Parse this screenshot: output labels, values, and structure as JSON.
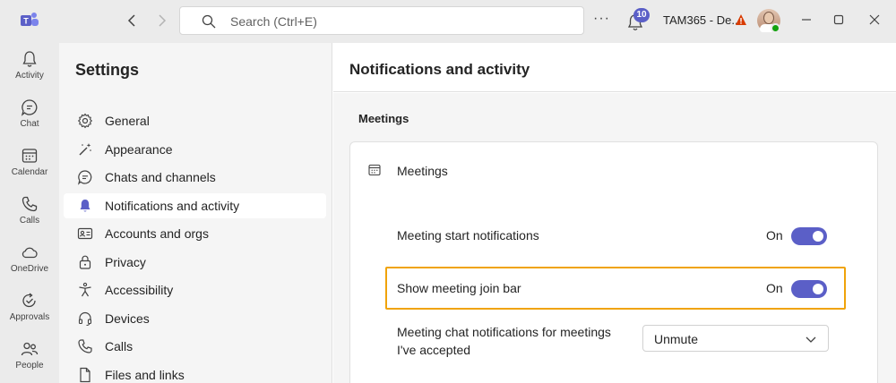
{
  "titlebar": {
    "search_placeholder": "Search (Ctrl+E)",
    "more_label": "···",
    "notification_count": "10",
    "tenant_label": "TAM365 - De...",
    "brand_color": "#5b5fc7"
  },
  "rail": {
    "items": [
      {
        "label": "Activity",
        "icon": "bell-icon"
      },
      {
        "label": "Chat",
        "icon": "chat-icon"
      },
      {
        "label": "Calendar",
        "icon": "calendar-icon"
      },
      {
        "label": "Calls",
        "icon": "phone-icon"
      },
      {
        "label": "OneDrive",
        "icon": "cloud-icon"
      },
      {
        "label": "Approvals",
        "icon": "approvals-icon"
      },
      {
        "label": "People",
        "icon": "people-icon"
      }
    ]
  },
  "settings": {
    "title": "Settings",
    "items": [
      {
        "label": "General",
        "icon": "gear-icon"
      },
      {
        "label": "Appearance",
        "icon": "wand-icon"
      },
      {
        "label": "Chats and channels",
        "icon": "chat-icon"
      },
      {
        "label": "Notifications and activity",
        "icon": "bell-icon",
        "active": true
      },
      {
        "label": "Accounts and orgs",
        "icon": "id-card-icon"
      },
      {
        "label": "Privacy",
        "icon": "lock-icon"
      },
      {
        "label": "Accessibility",
        "icon": "accessibility-icon"
      },
      {
        "label": "Devices",
        "icon": "headset-icon"
      },
      {
        "label": "Calls",
        "icon": "phone-icon"
      },
      {
        "label": "Files and links",
        "icon": "file-icon"
      }
    ]
  },
  "main": {
    "title": "Notifications and activity",
    "section_title": "Meetings",
    "card_title": "Meetings",
    "rows": [
      {
        "label": "Meeting start notifications",
        "state": "On",
        "toggle": true
      },
      {
        "label": "Show meeting join bar",
        "state": "On",
        "toggle": true,
        "highlighted": true
      },
      {
        "label": "Meeting chat notifications for meetings",
        "label_line2": "I've accepted",
        "dropdown_value": "Unmute"
      }
    ],
    "highlight_color": "#f0a30a"
  }
}
